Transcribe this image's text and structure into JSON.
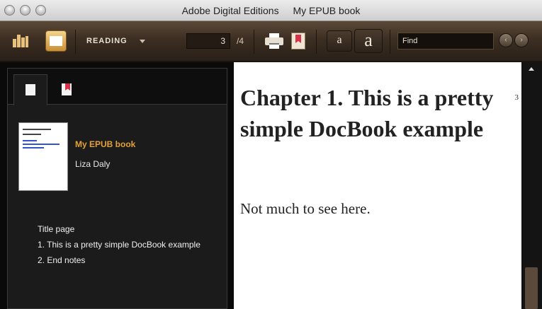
{
  "window": {
    "app_name": "Adobe Digital Editions",
    "document_name": "My EPUB book"
  },
  "toolbar": {
    "mode_label": "READING",
    "current_page": "3",
    "page_total": "/4",
    "font_small_label": "a",
    "font_large_label": "a",
    "find_placeholder": "Find",
    "prev_label": "‹",
    "next_label": "›"
  },
  "sidebar": {
    "book_title": "My EPUB book",
    "book_author": "Liza Daly",
    "toc": [
      "Title page",
      "1. This is a pretty simple DocBook example",
      "2. End notes"
    ]
  },
  "content": {
    "chapter_title": "Chapter 1. This is a pretty simple DocBook example",
    "page_marker": "3",
    "body_text": "Not much to see here."
  },
  "colors": {
    "toolbar_brown": "#3c2e22",
    "accent_gold": "#e2a13a",
    "bookmark_red": "#d8314a"
  }
}
